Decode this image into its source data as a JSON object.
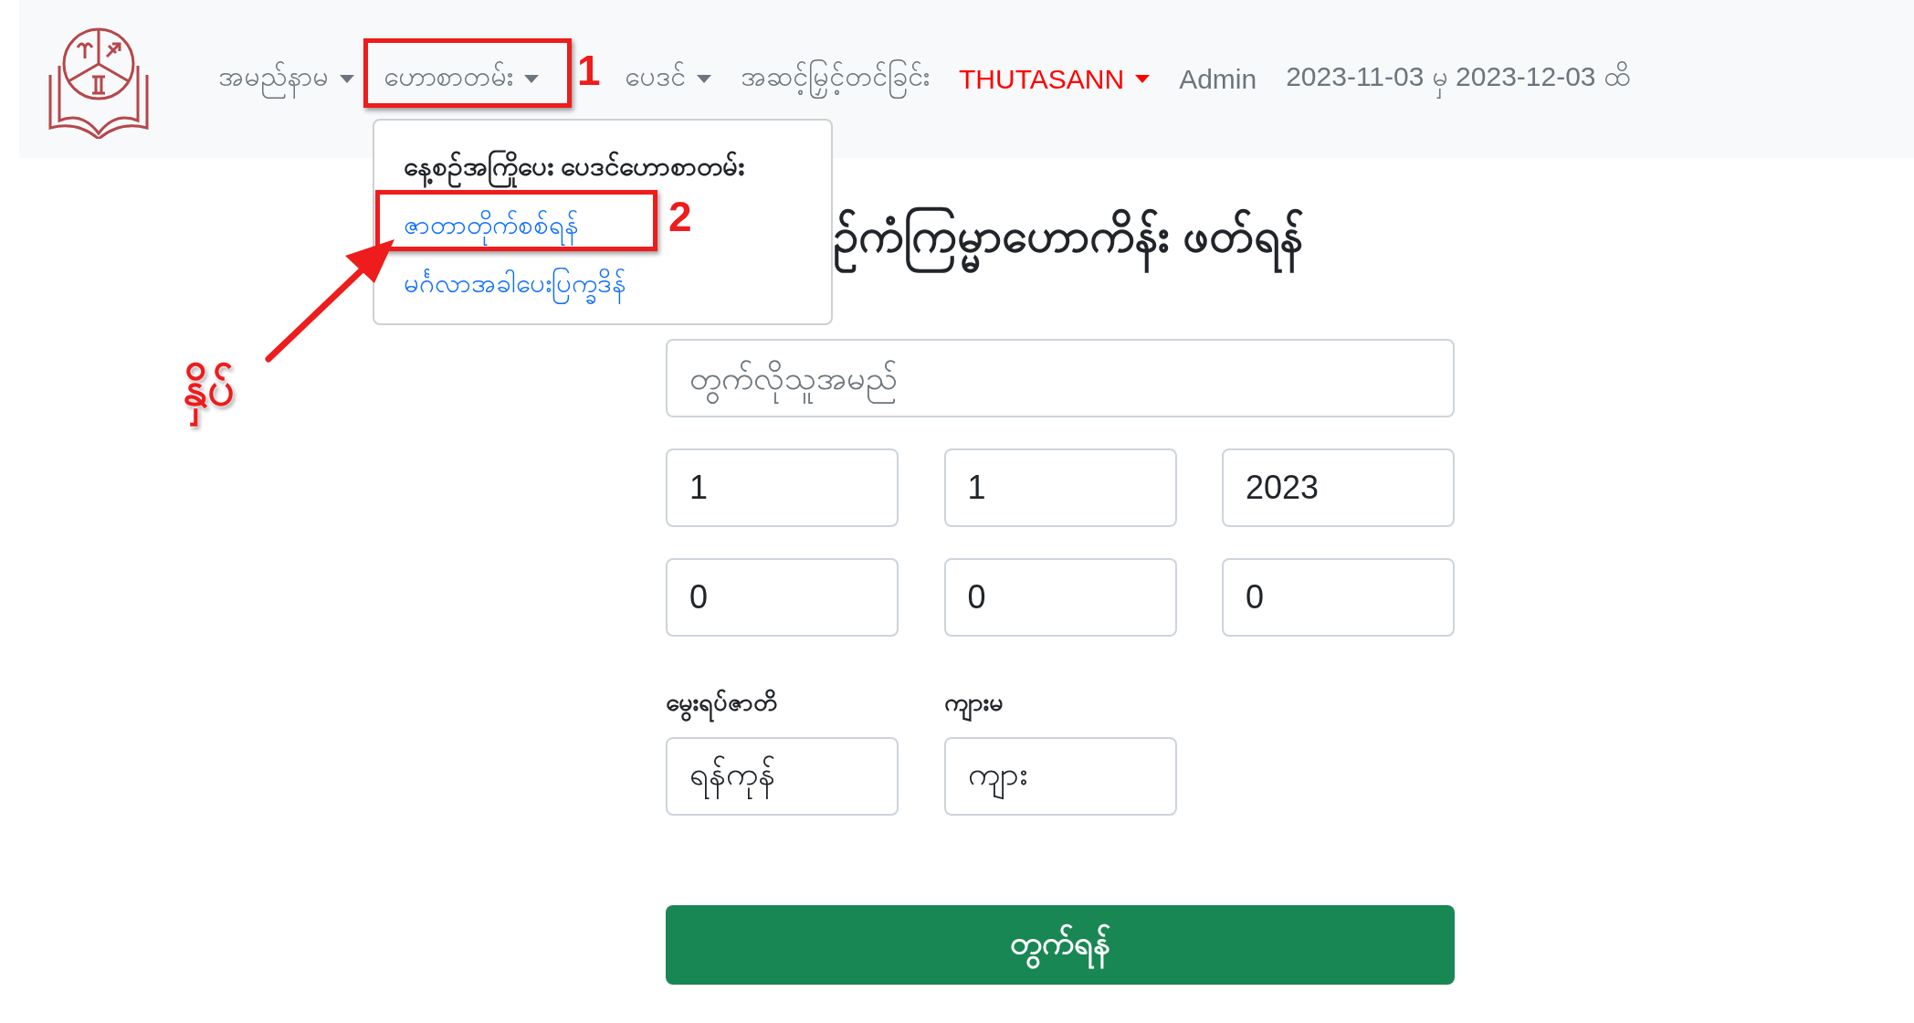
{
  "navbar": {
    "items": [
      {
        "label": "အမည်နာမ",
        "kind": "link",
        "caret": true
      },
      {
        "label": "ဟောစာတမ်း",
        "kind": "link",
        "caret": true
      },
      {
        "label": "ပေဒင်",
        "kind": "link",
        "caret": true
      },
      {
        "label": "အဆင့်မြှင့်တင်ခြင်း",
        "kind": "link",
        "caret": false
      },
      {
        "label": "THUTASANN",
        "kind": "user",
        "caret": true
      },
      {
        "label": "Admin",
        "kind": "link",
        "caret": false
      },
      {
        "label": "2023-11-03 မှ 2023-12-03 ထိ",
        "kind": "text",
        "caret": false
      }
    ]
  },
  "dropdown": {
    "items": [
      {
        "label": "နေ့စဉ်အကြိုပေး ပေဒင်ဟောစာတမ်း",
        "kind": "header"
      },
      {
        "label": "ဇာတာတိုက်စစ်ရန်",
        "kind": "link"
      },
      {
        "label": "မင်္ဂလာအခါပေးပြက္ခဒိန်",
        "kind": "link"
      }
    ]
  },
  "form": {
    "title": "ဉ်ကံကြမ္မာဟောကိန်း ဖတ်ရန်",
    "name_field": {
      "placeholder": "တွက်လိုသူအမည်"
    },
    "date_fields": [
      "1",
      "1",
      "2023"
    ],
    "time_fields": [
      "0",
      "0",
      "0"
    ],
    "birthplace": {
      "label": "မွေးရပ်ဇာတိ",
      "value": "ရန်ကုန်"
    },
    "gender": {
      "label": "ကျားမ",
      "value": "ကျား"
    },
    "submit": "တွက်ရန်"
  },
  "annotations": {
    "boxes": [
      {
        "label": "1"
      },
      {
        "label": "2"
      }
    ],
    "callout": "နှိပ်"
  }
}
